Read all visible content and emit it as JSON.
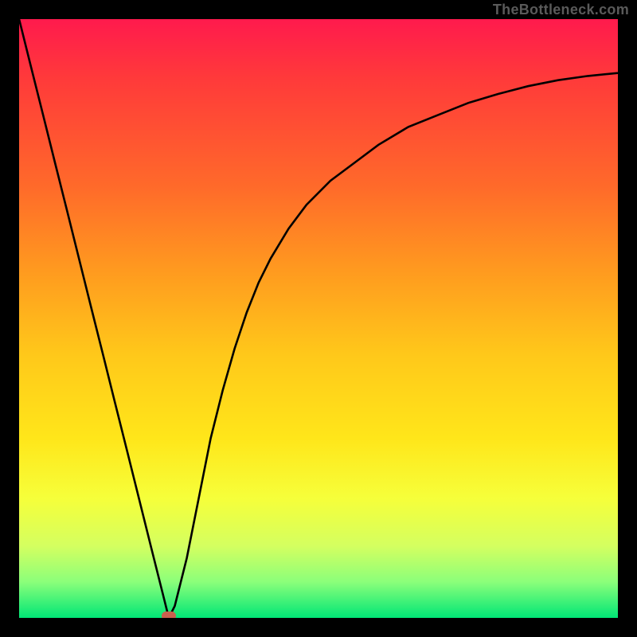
{
  "attribution": "TheBottleneck.com",
  "colors": {
    "frame": "#000000",
    "curve": "#000000",
    "marker": "#c9604e",
    "gradient_top": "#ff1a4d",
    "gradient_bottom": "#00e676"
  },
  "chart_data": {
    "type": "line",
    "title": "",
    "xlabel": "",
    "ylabel": "",
    "xlim": [
      0,
      100
    ],
    "ylim": [
      0,
      100
    ],
    "x": [
      0,
      2,
      4,
      6,
      8,
      10,
      12,
      14,
      16,
      18,
      20,
      22,
      24,
      25,
      26,
      28,
      30,
      32,
      34,
      36,
      38,
      40,
      42,
      45,
      48,
      52,
      56,
      60,
      65,
      70,
      75,
      80,
      85,
      90,
      95,
      100
    ],
    "values": [
      100,
      92,
      84,
      76,
      68,
      60,
      52,
      44,
      36,
      28,
      20,
      12,
      4,
      0,
      2,
      10,
      20,
      30,
      38,
      45,
      51,
      56,
      60,
      65,
      69,
      73,
      76,
      79,
      82,
      84,
      86,
      87.5,
      88.8,
      89.8,
      90.5,
      91
    ],
    "marker": {
      "x": 25,
      "y": 0
    },
    "annotations": []
  }
}
